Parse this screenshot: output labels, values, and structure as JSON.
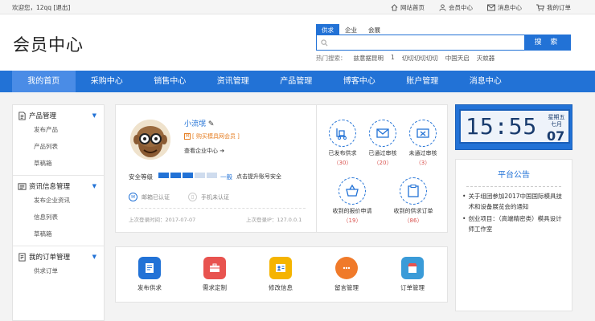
{
  "topbar": {
    "greeting": "欢迎您，12qq",
    "logout": "[退出]",
    "links": [
      {
        "label": "网站首页",
        "icon": "home-icon"
      },
      {
        "label": "会员中心",
        "icon": "user-icon"
      },
      {
        "label": "消息中心",
        "icon": "mail-icon"
      },
      {
        "label": "我的订单",
        "icon": "cart-icon"
      }
    ]
  },
  "header": {
    "logo": "会员中心",
    "search_tabs": [
      "供求",
      "企业",
      "会展"
    ],
    "search_button": "搜 索",
    "hot_label": "热门搜索：",
    "hot_terms": [
      "兹意据昆明",
      "1",
      "切切切切切切",
      "中国天启",
      "灭蚊器"
    ]
  },
  "nav": [
    "我的首页",
    "采购中心",
    "销售中心",
    "资讯管理",
    "产品管理",
    "博客中心",
    "账户管理",
    "消息中心"
  ],
  "sidebar": [
    {
      "title": "产品管理",
      "icon": "product-icon",
      "items": [
        "发布产品",
        "产品列表",
        "草稿箱"
      ]
    },
    {
      "title": "资讯信息管理",
      "icon": "news-icon",
      "items": [
        "发布企业资讯",
        "信息列表",
        "草稿箱"
      ]
    },
    {
      "title": "我的订单管理",
      "icon": "order-icon",
      "items": [
        "供求订单"
      ]
    }
  ],
  "profile": {
    "name": "小流氓",
    "badge": "[ 购买模具网会员 ]",
    "center_link": "查看企业中心",
    "security_label": "安全等级",
    "security_level": "一般",
    "security_filled": 3,
    "security_total": 5,
    "security_link": "点击提升账号安全",
    "email_auth": "邮箱已认证",
    "phone_auth": "手机未认证",
    "last_login_time": "上次登录时间：2017-07-07",
    "last_login_ip": "上次登录IP：127.0.0.1"
  },
  "orders": [
    {
      "label": "已发布供求",
      "count": "（30）",
      "icon": "forklift-icon"
    },
    {
      "label": "已通过审核",
      "count": "（20）",
      "icon": "approved-icon"
    },
    {
      "label": "未通过审核",
      "count": "（3）",
      "icon": "rejected-icon"
    },
    {
      "label": "收到的报价申请",
      "count": "（19）",
      "icon": "basket-icon"
    },
    {
      "label": "收到的供求订单",
      "count": "（86）",
      "icon": "clipboard-icon"
    }
  ],
  "quick": [
    {
      "label": "发布供求",
      "icon": "publish-icon",
      "color": "#2272d6"
    },
    {
      "label": "需求定制",
      "icon": "toolbox-icon",
      "color": "#e8534f"
    },
    {
      "label": "修改信息",
      "icon": "id-card-icon",
      "color": "#f5b400"
    },
    {
      "label": "留言管理",
      "icon": "chat-icon",
      "color": "#f07a2a"
    },
    {
      "label": "订单管理",
      "icon": "shop-icon",
      "color": "#3a9bd8"
    }
  ],
  "clock": {
    "time": "15:55",
    "weekday": "星期五",
    "month": "七月",
    "day": "07"
  },
  "notice": {
    "title": "平台公告",
    "items": [
      "关于组团参加2017中国国际模具技术和设备展览会的通知",
      "创业项目：（高端精密类）模具设计师工作室"
    ]
  },
  "colors": {
    "accent": "#2272d6",
    "count": "#d9534f"
  }
}
